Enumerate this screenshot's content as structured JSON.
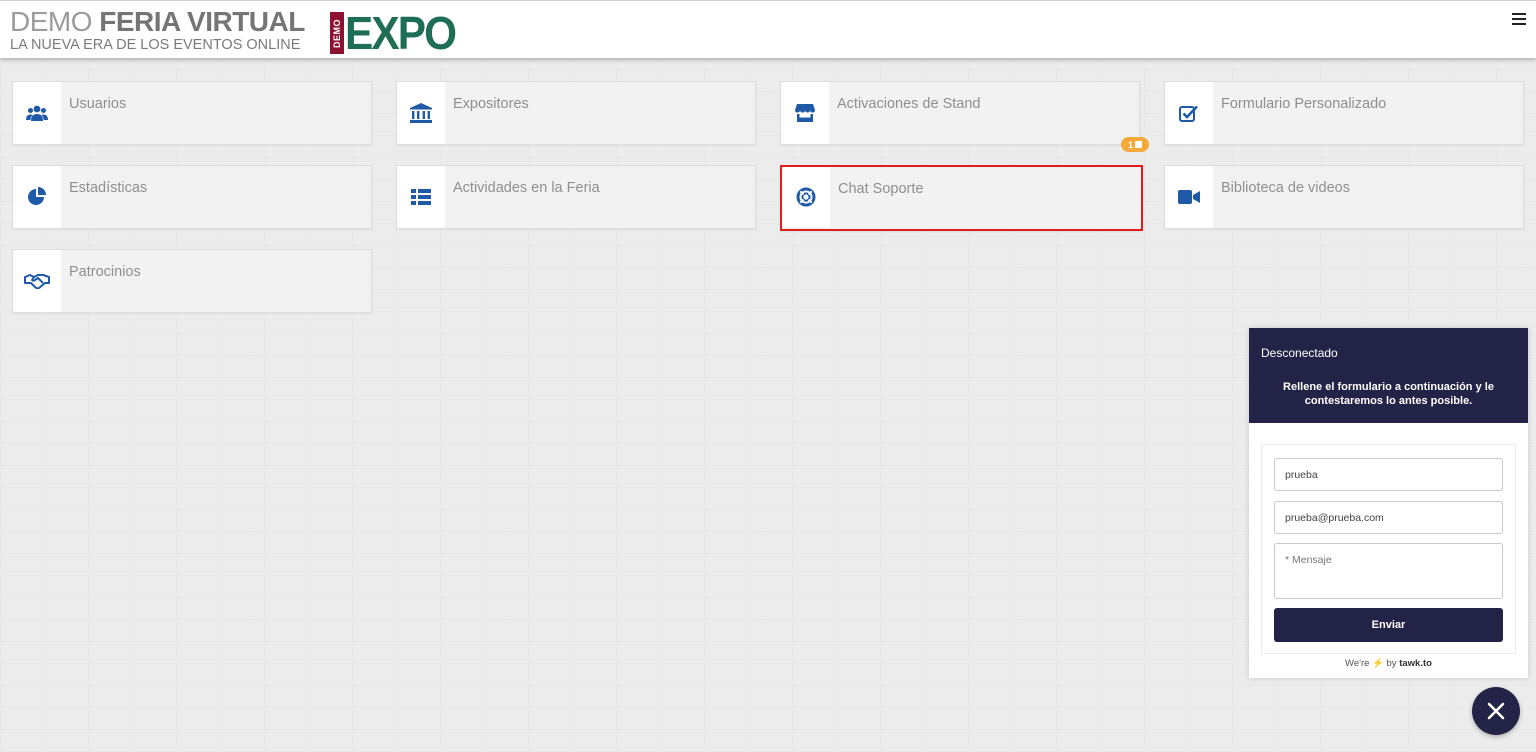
{
  "header": {
    "brand_thin": "DEMO",
    "brand_bold": "FERIA VIRTUAL",
    "tagline": "LA NUEVA ERA DE LOS EVENTOS ONLINE",
    "logo_small": "DEMO",
    "logo_big": "EXPO",
    "menu_icon": "hamburger-menu-icon"
  },
  "colors": {
    "accent_blue": "#1e5aa8",
    "chat_navy": "#232347",
    "logo_green": "#1d6e55",
    "logo_maroon": "#8e1230",
    "selection_red": "#e01c1c",
    "badge_orange": "#f4a93a"
  },
  "cards": [
    {
      "label": "Usuarios",
      "icon": "users-icon"
    },
    {
      "label": "Expositores",
      "icon": "bank-icon"
    },
    {
      "label": "Activaciones de Stand",
      "icon": "store-icon"
    },
    {
      "label": "Formulario Personalizado",
      "icon": "checkbox-icon"
    },
    {
      "label": "Estadísticas",
      "icon": "pie-chart-icon"
    },
    {
      "label": "Actividades en la Feria",
      "icon": "list-icon"
    },
    {
      "label": "Chat Soporte",
      "icon": "life-ring-icon",
      "selected": true
    },
    {
      "label": "Biblioteca de videos",
      "icon": "video-camera-icon"
    },
    {
      "label": "Patrocinios",
      "icon": "handshake-icon"
    }
  ],
  "badge": {
    "count": "1"
  },
  "chat": {
    "status": "Desconectado",
    "description": "Rellene el formulario a continuación y le contestaremos lo antes posible.",
    "name_value": "prueba",
    "email_value": "prueba@prueba.com",
    "message_placeholder": "* Mensaje",
    "send_label": "Enviar",
    "powered_pre": "We're",
    "powered_by": "by",
    "powered_brand": "tawk.to"
  }
}
